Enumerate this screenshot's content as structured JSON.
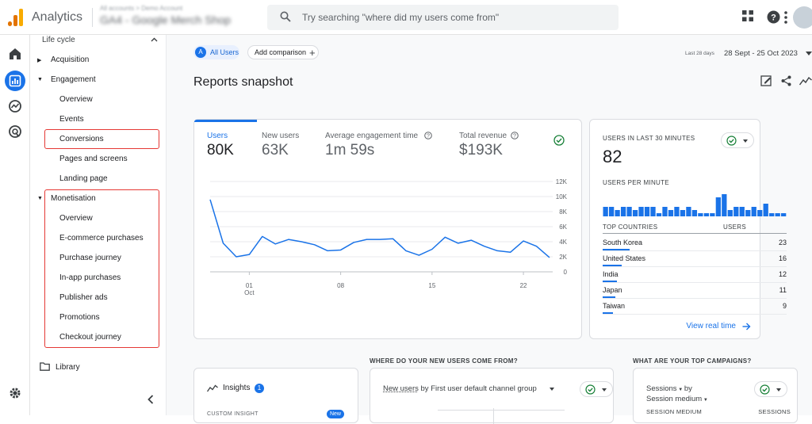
{
  "app": {
    "title": "Analytics",
    "account_line1": "All accounts > Demo Account",
    "account_line2": "GA4 - Google Merch Shop"
  },
  "search": {
    "placeholder": "Try searching \"where did my users come from\""
  },
  "colors": {
    "brand_orange": "#f9ab00",
    "brand_orange_dark": "#e37400",
    "accent_blue": "#1a73e8",
    "highlight_red": "#e53935",
    "success_green": "#188038"
  },
  "nav": {
    "section": "Life cycle",
    "acquisition": "Acquisition",
    "engagement": "Engagement",
    "engagement_items": [
      "Overview",
      "Events",
      "Conversions",
      "Pages and screens",
      "Landing page"
    ],
    "monetisation": "Monetisation",
    "monetisation_items": [
      "Overview",
      "E-commerce purchases",
      "Purchase journey",
      "In-app purchases",
      "Publisher ads",
      "Promotions",
      "Checkout journey"
    ],
    "library": "Library"
  },
  "header": {
    "segment_badge": "A",
    "segment": "All Users",
    "add_comparison": "Add comparison",
    "date_prefix": "Last 28 days",
    "date_range": "28 Sept - 25 Oct 2023",
    "page_title": "Reports snapshot"
  },
  "metrics": [
    {
      "label": "Users",
      "value": "80K"
    },
    {
      "label": "New users",
      "value": "63K"
    },
    {
      "label": "Average engagement time",
      "value": "1m 59s"
    },
    {
      "label": "Total revenue",
      "value": "$193K"
    }
  ],
  "chart_data": {
    "type": "line",
    "x_tick_labels": [
      "01",
      "Oct",
      "08",
      "15",
      "22"
    ],
    "y_tick_labels": [
      "12K",
      "10K",
      "8K",
      "6K",
      "4K",
      "2K",
      "0"
    ],
    "ylim": [
      0,
      12000
    ],
    "grid": true,
    "series": [
      {
        "values": [
          9600,
          3800,
          2000,
          2300,
          4700,
          3700,
          4300,
          4000,
          3600,
          2800,
          2900,
          3900,
          4300,
          4300,
          4400,
          2800,
          2200,
          3000,
          4600,
          3800,
          4200,
          3400,
          2800,
          2600,
          4100,
          3400,
          1900
        ]
      }
    ]
  },
  "realtime": {
    "title": "USERS IN LAST 30 MINUTES",
    "value": "82",
    "per_minute_label": "USERS PER MINUTE",
    "per_minute_bars": [
      3,
      3,
      2,
      3,
      3,
      2,
      3,
      3,
      3,
      1,
      3,
      2,
      3,
      2,
      3,
      2,
      1,
      1,
      1,
      6,
      7,
      2,
      3,
      3,
      2,
      3,
      2,
      4,
      1,
      1,
      1
    ],
    "col_country": "TOP COUNTRIES",
    "col_users": "USERS",
    "countries": [
      {
        "name": "South Korea",
        "users": "23",
        "share": 1.0
      },
      {
        "name": "United States",
        "users": "16",
        "share": 0.7
      },
      {
        "name": "India",
        "users": "12",
        "share": 0.52
      },
      {
        "name": "Japan",
        "users": "11",
        "share": 0.48
      },
      {
        "name": "Taiwan",
        "users": "9",
        "share": 0.39
      }
    ],
    "view_link": "View real time"
  },
  "bottom": {
    "insights_title": "Insights",
    "insights_count": "1",
    "insights_sub": "CUSTOM INSIGHT",
    "insights_badge": "New",
    "new_users_heading": "WHERE DO YOUR NEW USERS COME FROM?",
    "new_users_metric": "New users",
    "new_users_dim": "by First user default channel group",
    "campaigns_heading": "WHAT ARE YOUR TOP CAMPAIGNS?",
    "campaigns_metric": "Sessions",
    "campaigns_by": "by",
    "campaigns_dim": "Session medium",
    "col_medium": "SESSION MEDIUM",
    "col_sessions": "SESSIONS"
  }
}
